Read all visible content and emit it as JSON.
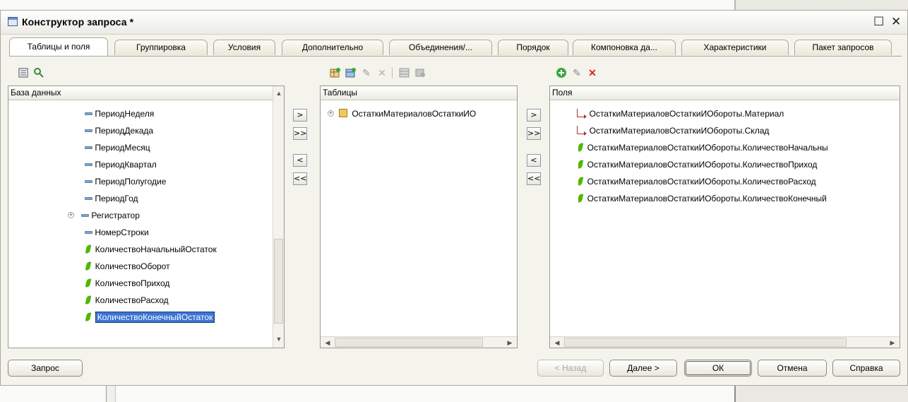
{
  "window": {
    "title": "Конструктор запроса *"
  },
  "tabs": [
    {
      "label": "Таблицы и поля",
      "active": true
    },
    {
      "label": "Группировка"
    },
    {
      "label": "Условия"
    },
    {
      "label": "Дополнительно"
    },
    {
      "label": "Объединения/..."
    },
    {
      "label": "Порядок"
    },
    {
      "label": "Компоновка да..."
    },
    {
      "label": "Характеристики"
    },
    {
      "label": "Пакет запросов"
    }
  ],
  "database_panel": {
    "header": "База данных",
    "items": [
      {
        "label": "ПериодНеделя",
        "icon": "field-dash-icon"
      },
      {
        "label": "ПериодДекада",
        "icon": "field-dash-icon"
      },
      {
        "label": "ПериодМесяц",
        "icon": "field-dash-icon"
      },
      {
        "label": "ПериодКвартал",
        "icon": "field-dash-icon"
      },
      {
        "label": "ПериодПолугодие",
        "icon": "field-dash-icon"
      },
      {
        "label": "ПериодГод",
        "icon": "field-dash-icon"
      },
      {
        "label": "Регистратор",
        "icon": "field-dash-icon",
        "expandable": true
      },
      {
        "label": "НомерСтроки",
        "icon": "field-dash-icon"
      },
      {
        "label": "КоличествоНачальныйОстаток",
        "icon": "resource-leaf-icon"
      },
      {
        "label": "КоличествоОборот",
        "icon": "resource-leaf-icon"
      },
      {
        "label": "КоличествоПриход",
        "icon": "resource-leaf-icon"
      },
      {
        "label": "КоличествоРасход",
        "icon": "resource-leaf-icon"
      },
      {
        "label": "КоличествоКонечныйОстаток",
        "icon": "resource-leaf-icon",
        "selected": true
      }
    ]
  },
  "tables_panel": {
    "header": "Таблицы",
    "items": [
      {
        "label": "ОстаткиМатериаловОстаткиИО",
        "icon": "table-icon",
        "expandable": true
      }
    ]
  },
  "fields_panel": {
    "header": "Поля",
    "items": [
      {
        "label": "ОстаткиМатериаловОстаткиИОбороты.Материал",
        "icon": "dimension-icon"
      },
      {
        "label": "ОстаткиМатериаловОстаткиИОбороты.Склад",
        "icon": "dimension-icon"
      },
      {
        "label": "ОстаткиМатериаловОстаткиИОбороты.КоличествоНачальны",
        "icon": "resource-leaf-icon"
      },
      {
        "label": "ОстаткиМатериаловОстаткиИОбороты.КоличествоПриход",
        "icon": "resource-leaf-icon"
      },
      {
        "label": "ОстаткиМатериаловОстаткиИОбороты.КоличествоРасход",
        "icon": "resource-leaf-icon"
      },
      {
        "label": "ОстаткиМатериаловОстаткиИОбороты.КоличествоКонечный",
        "icon": "resource-leaf-icon"
      }
    ]
  },
  "move_buttons": {
    "one_right": ">",
    "all_right": ">>",
    "one_left": "<",
    "all_left": "<<"
  },
  "footer": {
    "query_button": "Запрос",
    "back_button": "< Назад",
    "next_button": "Далее >",
    "ok_button": "ОК",
    "cancel_button": "Отмена",
    "help_button": "Справка"
  },
  "colors": {
    "selection": "#3b74d4",
    "delete_red": "#d8261e",
    "add_green": "#36a93a",
    "leaf_green": "#4fb800"
  }
}
